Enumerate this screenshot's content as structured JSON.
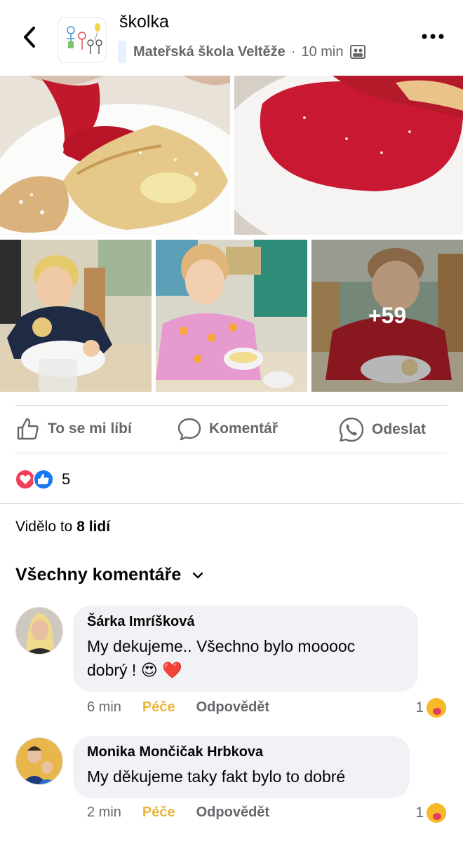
{
  "header": {
    "group_name": "školka",
    "school": "Mateřská škola Veltěže",
    "time": "10 min"
  },
  "photos": {
    "more_count": "+59"
  },
  "actions": {
    "like": "To se mi líbí",
    "comment": "Komentář",
    "send": "Odeslat"
  },
  "reactions": {
    "count": "5"
  },
  "seen": {
    "prefix": "Vidělo to",
    "value": "8 lidí"
  },
  "comments_header": "Všechny komentáře",
  "comments": [
    {
      "name": "Šárka Imríšková",
      "text_line1": "My dekujeme.. Všechno bylo mooooc",
      "text_line2": "dobrý !",
      "emoji": "😍 ❤️",
      "time": "6 min",
      "care": "Péče",
      "reply": "Odpovědět",
      "reaction_count": "1"
    },
    {
      "name": "Monika Mončičak Hrbkova",
      "text_line1": "My děkujeme taky fakt bylo to dobré",
      "time": "2 min",
      "care": "Péče",
      "reply": "Odpovědět",
      "reaction_count": "1"
    }
  ],
  "colors": {
    "secondary_text": "#65676b",
    "care": "#e8b53f",
    "bubble": "#f0f2f5",
    "like_blue": "#1877f2",
    "love_red": "#f33e58"
  }
}
